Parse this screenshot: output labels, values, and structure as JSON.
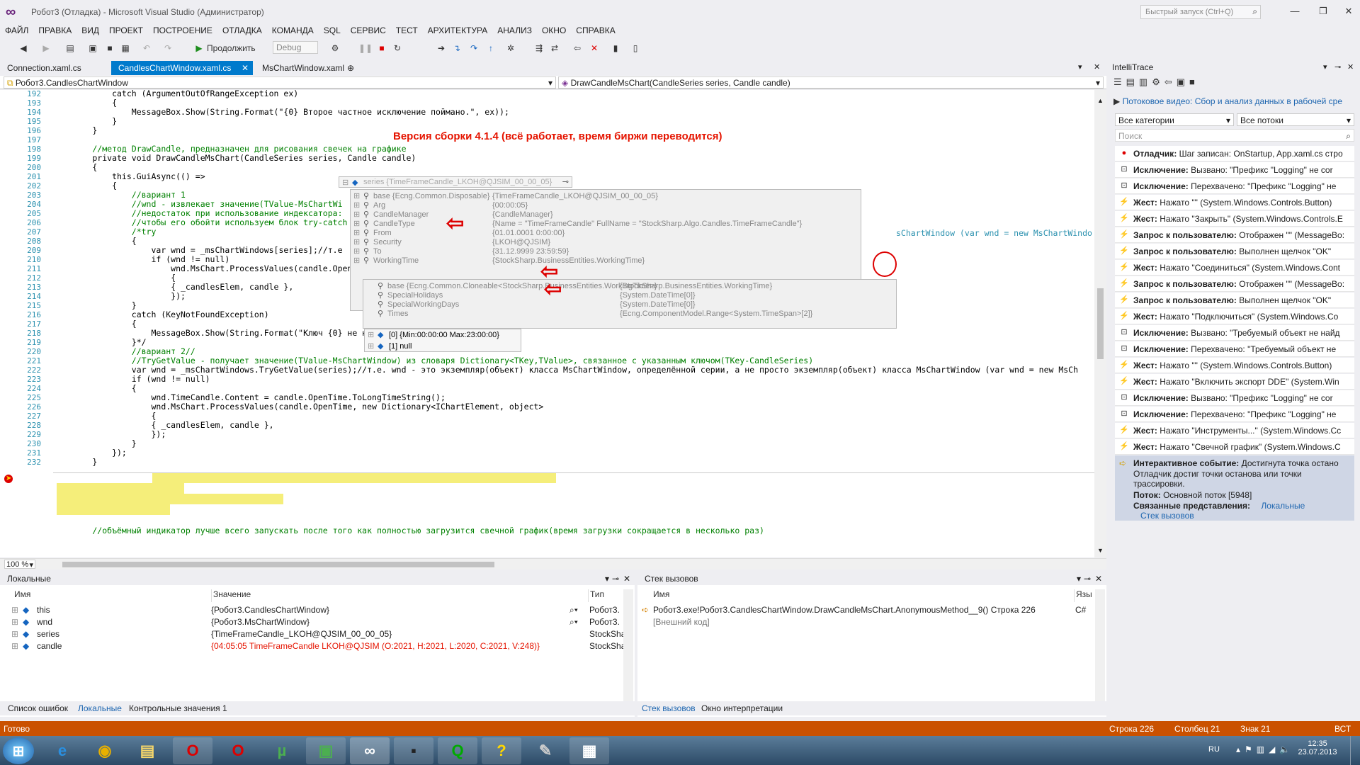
{
  "window": {
    "title": "Робот3 (Отладка) - Microsoft Visual Studio (Администратор)",
    "quick_launch_placeholder": "Быстрый запуск (Ctrl+Q)"
  },
  "menu": [
    "ФАЙЛ",
    "ПРАВКА",
    "ВИД",
    "ПРОЕКТ",
    "ПОСТРОЕНИЕ",
    "ОТЛАДКА",
    "КОМАНДА",
    "SQL",
    "СЕРВИС",
    "ТЕСТ",
    "АРХИТЕКТУРА",
    "АНАЛИЗ",
    "ОКНО",
    "СПРАВКА"
  ],
  "toolbar": {
    "continue_label": "Продолжить",
    "config": "Debug"
  },
  "tabs": [
    "Connection.xaml.cs",
    "CandlesChartWindow.xaml.cs",
    "MsChartWindow.xaml"
  ],
  "nav": {
    "left": "Робот3.CandlesChartWindow",
    "right": "DrawCandleMsChart(CandleSeries series, Candle candle)"
  },
  "build_note": "Версия сборки 4.1.4 (всё работает, время биржи переводится)",
  "line_numbers": [
    "192",
    "193",
    "194",
    "195",
    "196",
    "197",
    "198",
    "199",
    "200",
    "201",
    "202",
    "203",
    "204",
    "205",
    "206",
    "207",
    "208",
    "209",
    "210",
    "211",
    "212",
    "213",
    "214",
    "215",
    "216",
    "217",
    "218",
    "219",
    "220",
    "221",
    "222",
    "223",
    "224",
    "225",
    "226",
    "227",
    "228",
    "229",
    "230",
    "231",
    "232"
  ],
  "code_lines": [
    "            catch (ArgumentOutOfRangeException ex)",
    "            {",
    "                MessageBox.Show(String.Format(\"{0} Второе частное исключение поймано.\", ex));",
    "            }",
    "        }",
    "",
    "        //метод DrawCandle, предназначен для рисования свечек на графике",
    "        private void DrawCandleMsChart(CandleSeries series, Candle candle)",
    "        {",
    "            this.GuiAsync(() =>",
    "            {",
    "                //вариант 1",
    "                //wnd - извлекает значение(TValue-MsChartWi",
    "                //недостаток при использование индексатора:",
    "                //чтобы его обойти используем блок try-catch",
    "                /*try",
    "                {",
    "                    var wnd = _msChartWindows[series];//т.е",
    "                    if (wnd != null)",
    "                        wnd.MsChart.ProcessValues(candle.OpenT",
    "                        {",
    "                        { _candlesElem, candle },",
    "                        });",
    "                }",
    "                catch (KeyNotFoundException)",
    "                {",
    "                    MessageBox.Show(String.Format(\"Ключ {0} не найден\", series));",
    "                }*/",
    "                //вариант 2//",
    "                //TryGetValue - получает значение(TValue-MsChartWindow) из словаря Dictionary<TKey,TValue>, связанное с указанным ключом(TKey-CandleSeries)",
    "                var wnd = _msChartWindows.TryGetValue(series);//т.е. wnd - это экземпляр(объект) класса MsChartWindow, определённой серии, а не просто экземпляр(объект) класса MsChartWindow (var wnd = new MsCh",
    "                if (wnd != null)",
    "                {",
    "                    wnd.TimeCandle.Content = candle.OpenTime.ToLongTimeString();",
    "                    wnd.MsChart.ProcessValues(candle.OpenTime, new Dictionary<IChartElement, object>",
    "                    {",
    "                    { _candlesElem, candle },",
    "                    });",
    "                }",
    "            });",
    "        }"
  ],
  "code_last": "        //объёмный индикатор лучше всего запускать после того как полностью загрузится свечной график(время загрузки сокращается в несколько раз)",
  "code_right_208": "sChartWindow (var wnd = new MsChartWindo",
  "datatip": {
    "header": "series {TimeFrameCandle_LKOH@QJSIM_00_00_05}",
    "rows": [
      {
        "name": "base {Ecng.Common.Disposable}",
        "value": "{TimeFrameCandle_LKOH@QJSIM_00_00_05}"
      },
      {
        "name": "Arg",
        "value": "{00:00:05}"
      },
      {
        "name": "CandleManager",
        "value": "{CandleManager}"
      },
      {
        "name": "CandleType",
        "value": "{Name = \"TimeFrameCandle\" FullName = \"StockSharp.Algo.Candles.TimeFrameCandle\"}"
      },
      {
        "name": "From",
        "value": "{01.01.0001 0:00:00}"
      },
      {
        "name": "Security",
        "value": "{LKOH@QJSIM}"
      },
      {
        "name": "To",
        "value": "{31.12.9999 23:59:59}"
      },
      {
        "name": "WorkingTime",
        "value": "{StockSharp.BusinessEntities.WorkingTime}"
      }
    ],
    "sub_rows": [
      {
        "name": "base {Ecng.Common.Cloneable<StockSharp.BusinessEntities.WorkingTime>}",
        "value": "{StockSharp.BusinessEntities.WorkingTime}"
      },
      {
        "name": "SpecialHolidays",
        "value": "{System.DateTime[0]}"
      },
      {
        "name": "SpecialWorkingDays",
        "value": "{System.DateTime[0]}"
      },
      {
        "name": "Times",
        "value": "{Ecng.ComponentModel.Range<System.TimeSpan>[2]}"
      }
    ],
    "times": [
      "[0]  {Min:00:00:00 Max:23:00:00}",
      "[1]  null"
    ]
  },
  "zoom": "100 %",
  "intellitrace": {
    "title": "IntelliTrace",
    "video_link": "Потоковое видео: Сбор и анализ данных в рабочей сре",
    "filter1": "Все категории",
    "filter2": "Все потоки",
    "search": "Поиск",
    "events": [
      {
        "type": "Отладчик:",
        "text": "Шаг записан: OnStartup, App.xaml.cs стро",
        "icon": "record-icon"
      },
      {
        "type": "Исключение:",
        "text": "Вызвано: \"Префикс \"Logging\" не cor",
        "icon": "exception-icon"
      },
      {
        "type": "Исключение:",
        "text": "Перехвачено: \"Префикс \"Logging\" не",
        "icon": "exception-icon"
      },
      {
        "type": "Жест:",
        "text": "Нажато \"\" (System.Windows.Controls.Button)",
        "icon": "gesture-icon"
      },
      {
        "type": "Жест:",
        "text": "Нажато \"Закрыть\" (System.Windows.Controls.E",
        "icon": "gesture-icon"
      },
      {
        "type": "Запрос к пользователю:",
        "text": "Отображен \"\" (MessageBo:",
        "icon": "gesture-icon"
      },
      {
        "type": "Запрос к пользователю:",
        "text": "Выполнен щелчок \"OK\"",
        "icon": "gesture-icon"
      },
      {
        "type": "Жест:",
        "text": "Нажато \"Соединиться\" (System.Windows.Cont",
        "icon": "gesture-icon"
      },
      {
        "type": "Запрос к пользователю:",
        "text": "Отображен \"\" (MessageBo:",
        "icon": "gesture-icon"
      },
      {
        "type": "Запрос к пользователю:",
        "text": "Выполнен щелчок \"OK\"",
        "icon": "gesture-icon"
      },
      {
        "type": "Жест:",
        "text": "Нажато \"Подключиться\" (System.Windows.Co",
        "icon": "gesture-icon"
      },
      {
        "type": "Исключение:",
        "text": "Вызвано: \"Требуемый объект не найд",
        "icon": "exception-icon"
      },
      {
        "type": "Исключение:",
        "text": "Перехвачено: \"Требуемый объект не",
        "icon": "exception-icon"
      },
      {
        "type": "Жест:",
        "text": "Нажато \"\" (System.Windows.Controls.Button)",
        "icon": "gesture-icon"
      },
      {
        "type": "Жест:",
        "text": "Нажато \"Включить экспорт DDE\" (System.Win",
        "icon": "gesture-icon"
      },
      {
        "type": "Исключение:",
        "text": "Вызвано: \"Префикс \"Logging\" не cor",
        "icon": "exception-icon"
      },
      {
        "type": "Исключение:",
        "text": "Перехвачено: \"Префикс \"Logging\" не",
        "icon": "exception-icon"
      },
      {
        "type": "Жест:",
        "text": "Нажато \"Инструменты...\" (System.Windows.Cc",
        "icon": "gesture-icon"
      },
      {
        "type": "Жест:",
        "text": "Нажато \"Свечной график\" (System.Windows.C",
        "icon": "gesture-icon"
      }
    ],
    "interactive": {
      "type": "Интерактивное событие:",
      "text": "Достигнута точка остано",
      "line2": "Отладчик достиг точки останова или точки",
      "line3": "трассировки.",
      "thread_label": "Поток:",
      "thread_value": "Основной поток [5948]",
      "views_label": "Связанные представления:",
      "views_link": "Локальные",
      "callstack_link": "Стек вызовов"
    }
  },
  "locals": {
    "title": "Локальные",
    "col_name": "Имя",
    "col_value": "Значение",
    "col_type": "Тип",
    "rows": [
      {
        "name": "this",
        "value": "{Робот3.CandlesChartWindow}",
        "type": "Робот3.",
        "changed": false
      },
      {
        "name": "wnd",
        "value": "{Робот3.MsChartWindow}",
        "type": "Робот3.",
        "changed": false
      },
      {
        "name": "series",
        "value": "{TimeFrameCandle_LKOH@QJSIM_00_00_05}",
        "type": "StockSha",
        "changed": false
      },
      {
        "name": "candle",
        "value": "{04:05:05 TimeFrameCandle LKOH@QJSIM (O:2021, H:2021, L:2020, C:2021, V:248)}",
        "type": "StockSha",
        "changed": true
      }
    ]
  },
  "callstack": {
    "title": "Стек вызовов",
    "col_name": "Имя",
    "col_lang": "Язы",
    "rows": [
      {
        "name": "Робот3.exe!Робот3.CandlesChartWindow.DrawCandleMsChart.AnonymousMethod__9() Строка 226",
        "lang": "C#"
      },
      {
        "name": "[Внешний код]",
        "lang": ""
      }
    ]
  },
  "bottom_tabs_left": [
    "Список ошибок",
    "Локальные",
    "Контрольные значения 1"
  ],
  "bottom_tabs_right": [
    "Стек вызовов",
    "Окно интерпретации"
  ],
  "status": {
    "ready": "Готово",
    "line": "Строка 226",
    "col": "Столбец 21",
    "char": "Знак 21",
    "mode": "ВСТ"
  },
  "taskbar": {
    "lang": "RU",
    "time": "12:35",
    "date": "23.07.2013"
  },
  "colors": {
    "accent": "#007acc",
    "status": "#ca5100",
    "error": "#e51400",
    "highlight": "#f5ee7a"
  }
}
